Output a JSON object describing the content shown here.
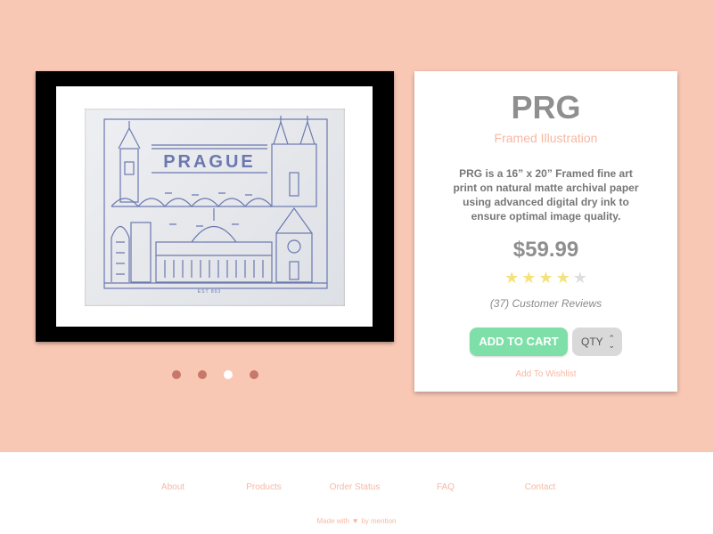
{
  "product": {
    "title": "PRG",
    "subtitle": "Framed Illustration",
    "description": "PRG is a 16” x 20” Framed fine art print on natural matte archival paper using advanced digital dry ink to ensure optimal image quality.",
    "price": "$59.99",
    "rating": 4,
    "rating_max": 5,
    "reviews_label": "(37) Customer Reviews",
    "add_to_cart_label": "ADD TO CART",
    "qty_label": "QTY",
    "wishlist_label": "Add To Wishlist"
  },
  "artwork": {
    "city_name": "PRAGUE",
    "est_label": "EST 893",
    "line_color": "#6b78b0"
  },
  "carousel": {
    "count": 4,
    "active_index": 2
  },
  "footer": {
    "nav": [
      "About",
      "Products",
      "Order Status",
      "FAQ",
      "Contact"
    ],
    "made_prefix": "Made with",
    "made_suffix": "by mention"
  },
  "colors": {
    "background": "#f9c8b5",
    "accent_text": "#f8b7a0",
    "cart_button": "#7ee0a8",
    "star_on": "#f4e27a",
    "star_off": "#dedede",
    "dot": "#c8786a"
  }
}
